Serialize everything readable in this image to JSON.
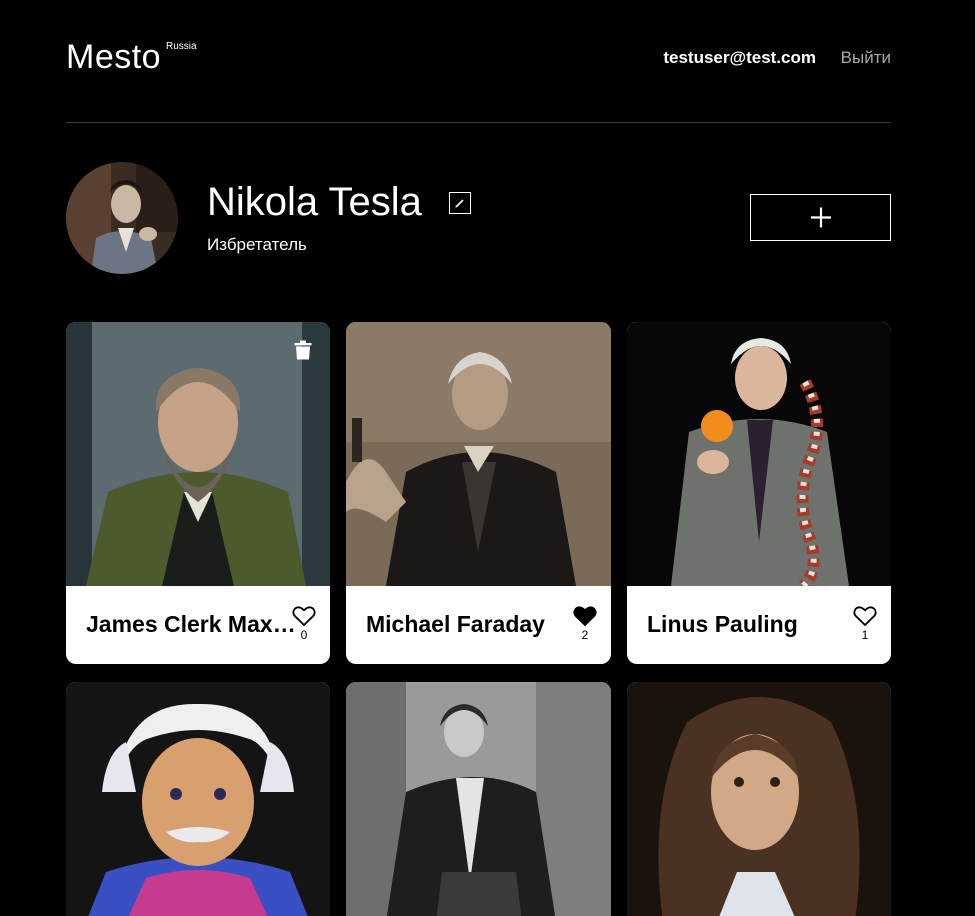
{
  "header": {
    "logo": "Mesto",
    "logo_sup": "Russia",
    "email": "testuser@test.com",
    "logout": "Выйти"
  },
  "profile": {
    "name": "Nikola Tesla",
    "about": "Избретатель"
  },
  "cards": [
    {
      "title": "James Clerk Maxwell",
      "likes": "0",
      "liked": false,
      "own": true
    },
    {
      "title": "Michael Faraday",
      "likes": "2",
      "liked": true,
      "own": false
    },
    {
      "title": "Linus Pauling",
      "likes": "1",
      "liked": false,
      "own": false
    },
    {
      "title": "",
      "likes": "",
      "liked": false,
      "own": false
    },
    {
      "title": "",
      "likes": "",
      "liked": false,
      "own": false
    },
    {
      "title": "",
      "likes": "",
      "liked": false,
      "own": false
    }
  ],
  "icons": {
    "edit": "pencil-icon",
    "add": "plus-icon",
    "like": "heart-icon",
    "delete": "trash-icon"
  },
  "colors": {
    "background": "#000000",
    "card": "#ffffff",
    "logout": "#a9a9a9"
  }
}
